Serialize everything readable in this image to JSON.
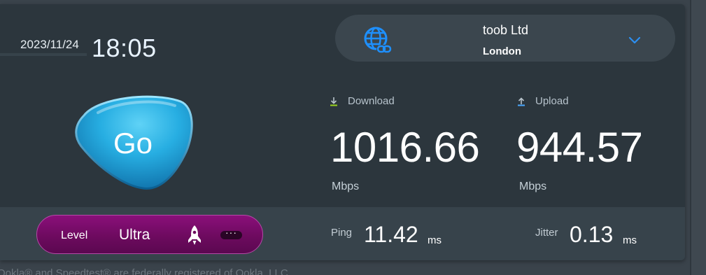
{
  "header": {
    "date": "2023/11/24",
    "time": "18:05"
  },
  "server": {
    "name": "toob Ltd",
    "city": "London",
    "icon": "globe-link-icon",
    "expand_icon": "chevron-down-icon"
  },
  "go_button": {
    "label": "Go"
  },
  "download": {
    "label": "Download",
    "value": "1016.66",
    "unit": "Mbps",
    "icon": "download-arrow-icon"
  },
  "upload": {
    "label": "Upload",
    "value": "944.57",
    "unit": "Mbps",
    "icon": "upload-arrow-icon"
  },
  "level": {
    "label": "Level",
    "value": "Ultra",
    "icon": "rocket-icon",
    "more_label": "···"
  },
  "ping": {
    "label": "Ping",
    "value": "11.42",
    "unit": "ms"
  },
  "jitter": {
    "label": "Jitter",
    "value": "0.13",
    "unit": "ms"
  },
  "footer": {
    "text": "Ookla® and Speedtest® are federally registered of Ookla, LLC"
  },
  "colors": {
    "accent_blue": "#1e90ff",
    "go_button": "#2bb0e6",
    "level_pill": "#7a0d6c",
    "download_arrow": "#9bd41e",
    "upload_arrow": "#4aa8ff",
    "card_bg": "#2c363d"
  }
}
